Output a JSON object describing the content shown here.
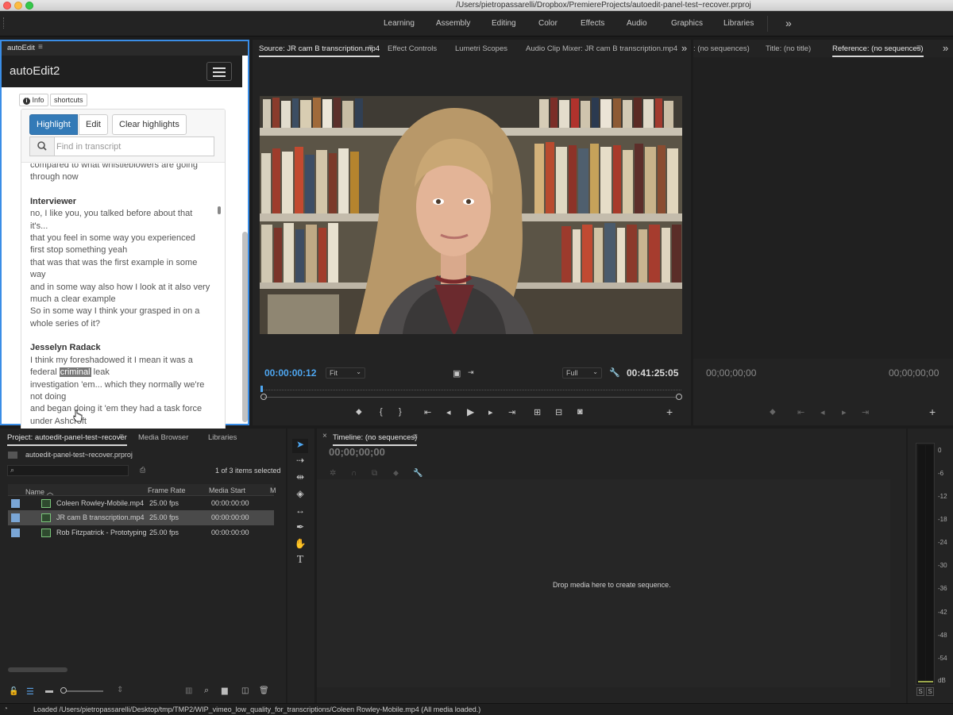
{
  "window": {
    "title": "/Users/pietropassarelli/Dropbox/PremiereProjects/autoedit-panel-test~recover.prproj"
  },
  "workspaces": [
    "Learning",
    "Assembly",
    "Editing",
    "Color",
    "Effects",
    "Audio",
    "Graphics",
    "Libraries"
  ],
  "workspace_overflow": "»",
  "autoedit": {
    "tab_label": "autoEdit",
    "brand": "autoEdit2",
    "info_label": "Info",
    "shortcuts_label": "shortcuts",
    "highlight_label": "Highlight",
    "edit_label": "Edit",
    "clear_label": "Clear highlights",
    "search_placeholder": "Find in transcript",
    "transcript": {
      "lead_lines": [
        "compared to what whistleblowers are going",
        "through now"
      ],
      "interviewer_name": "Interviewer",
      "interviewer_lines": [
        "no, I like you, you talked before about that",
        "it's...",
        "that you feel in some way you experienced",
        "first stop something yeah",
        "that was that was the first example in some",
        "way",
        "and in some way also how I look at it also very",
        "much a clear example",
        "So in some way I think your grasped in on a",
        "whole series of it?"
      ],
      "jesselyn_name": "Jesselyn Radack",
      "jesselyn_line1": "I think my foreshadowed it I mean it was a",
      "federal_word": "federal",
      "criminal_word": "criminal",
      "leak_word": "leak",
      "jesselyn_rest": [
        "investigation 'em... which they normally we're",
        "not doing",
        "and began doing it 'em they had a task force",
        "under Ashcroft"
      ]
    }
  },
  "source": {
    "tabs": [
      "Source: JR cam B transcription.mp4",
      "Effect Controls",
      "Lumetri Scopes",
      "Audio Clip Mixer: JR cam B transcription.mp4"
    ],
    "timecode_in": "00:00:00:12",
    "fit_label": "Fit",
    "quality_label": "Full",
    "duration": "00:41:25:05"
  },
  "program": {
    "tabs": [
      ": (no sequences)",
      "Title: (no title)",
      "Reference: (no sequences)"
    ],
    "timecode_left": "00;00;00;00",
    "timecode_right": "00;00;00;00"
  },
  "project": {
    "tabs": [
      "Project: autoedit-panel-test~recover",
      "Media Browser",
      "Libraries"
    ],
    "file_name": "autoedit-panel-test~recover.prproj",
    "count_label": "1 of 3 items selected",
    "columns": [
      "Name",
      "Frame Rate",
      "Media Start",
      "M"
    ],
    "rows": [
      {
        "name": "Coleen Rowley-Mobile.mp4",
        "frame_rate": "25.00 fps",
        "media_start": "00:00:00:00"
      },
      {
        "name": "JR cam B transcription.mp4",
        "frame_rate": "25.00 fps",
        "media_start": "00:00:00:00"
      },
      {
        "name": "Rob Fitzpatrick - Prototyping",
        "frame_rate": "25.00 fps",
        "media_start": "00:00:00:00"
      }
    ]
  },
  "timeline": {
    "tab_label": "Timeline: (no sequences)",
    "timecode": "00;00;00;00",
    "drop_hint": "Drop media here to create sequence."
  },
  "meter": {
    "scale": [
      "0",
      "-6",
      "-12",
      "-18",
      "-24",
      "-30",
      "-36",
      "-42",
      "-48",
      "-54",
      "dB"
    ],
    "solo_labels": [
      "S",
      "S"
    ]
  },
  "status": {
    "message": "Loaded /Users/pietropassarelli/Desktop/tmp/TMP2/WIP_vimeo_low_quality_for_transcriptions/Coleen Rowley-Mobile.mp4 (All media loaded.)"
  },
  "colors": {
    "accent_blue": "#337ab7",
    "panel_focus": "#3a8de6",
    "timecode_blue": "#4ea6f0"
  }
}
